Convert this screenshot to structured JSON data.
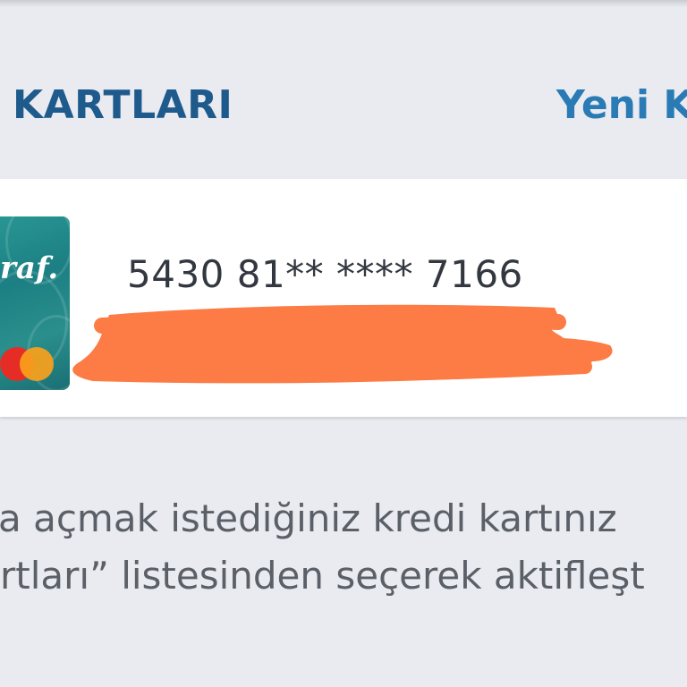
{
  "header": {
    "title": "KARTLARI",
    "new_card_link": "Yeni K"
  },
  "card": {
    "brand_text": "raf.",
    "masked_number": "5430 81** **** 7166",
    "network": "Mastercard",
    "network_colors": [
      "#e52d26",
      "#f9a11b"
    ],
    "redaction_color": "#fd7b45"
  },
  "info": {
    "line1": "a açmak istediğiniz kredi kartınız",
    "line2": "rtları” listesinden seçerek aktifleşt"
  },
  "colors": {
    "title": "#1e5a8c",
    "link": "#2a7bb5",
    "background": "#e9ebf0",
    "card_row": "#ffffff"
  }
}
